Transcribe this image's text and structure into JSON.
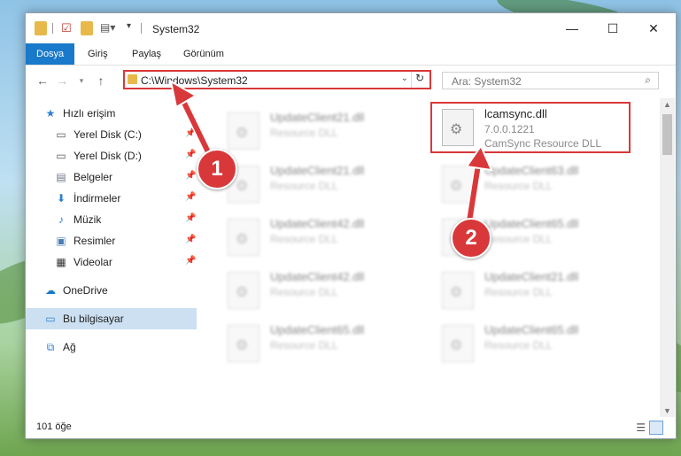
{
  "window": {
    "title": "System32"
  },
  "ribbon": {
    "tabs": [
      "Dosya",
      "Giriş",
      "Paylaş",
      "Görünüm"
    ]
  },
  "address": {
    "path": "C:\\Windows\\System32",
    "search_placeholder": "Ara: System32"
  },
  "nav": {
    "items": [
      {
        "label": "Hızlı erişim",
        "icon": "star-icon"
      },
      {
        "label": "Yerel Disk (C:)",
        "icon": "drive-icon"
      },
      {
        "label": "Yerel Disk (D:)",
        "icon": "drive-icon"
      },
      {
        "label": "Belgeler",
        "icon": "documents-icon"
      },
      {
        "label": "İndirmeler",
        "icon": "download-icon"
      },
      {
        "label": "Müzik",
        "icon": "music-icon"
      },
      {
        "label": "Resimler",
        "icon": "pictures-icon"
      },
      {
        "label": "Videolar",
        "icon": "video-icon"
      },
      {
        "label": "OneDrive",
        "icon": "cloud-icon"
      },
      {
        "label": "Bu bilgisayar",
        "icon": "computer-icon"
      },
      {
        "label": "Ağ",
        "icon": "network-icon"
      }
    ]
  },
  "files": {
    "highlighted": {
      "name": "lcamsync.dll",
      "version": "7.0.0.1221",
      "desc": "CamSync Resource DLL"
    },
    "left_col": [
      {
        "name": "UpdateClient21.dll",
        "desc": "Resource DLL"
      },
      {
        "name": "UpdateClient21.dll",
        "desc": "Resource DLL"
      },
      {
        "name": "UpdateClient42.dll",
        "desc": "Resource DLL"
      },
      {
        "name": "UpdateClient42.dll",
        "desc": "Resource DLL"
      },
      {
        "name": "UpdateClient65.dll",
        "desc": "Resource DLL"
      }
    ],
    "right_col": [
      {
        "name": "UpdateClient63.dll",
        "desc": "Resource DLL"
      },
      {
        "name": "UpdateClient65.dll",
        "desc": "Resource DLL"
      },
      {
        "name": "UpdateClient21.dll",
        "desc": "Resource DLL"
      },
      {
        "name": "UpdateClient65.dll",
        "desc": "Resource DLL"
      }
    ]
  },
  "status": {
    "count": "101 öğe"
  },
  "callouts": [
    "1",
    "2"
  ],
  "colors": {
    "accent": "#1979ca",
    "highlight": "#d9383a",
    "selection": "#cce0f2"
  }
}
